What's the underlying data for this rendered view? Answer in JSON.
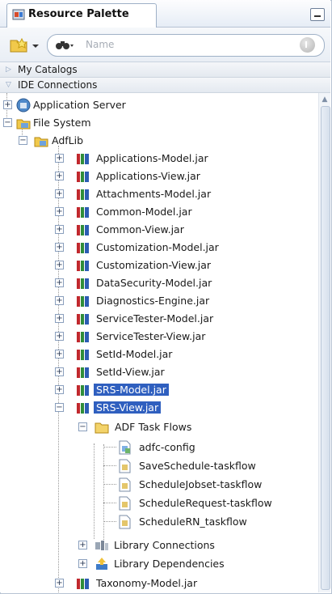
{
  "panel": {
    "title": "Resource Palette"
  },
  "search": {
    "placeholder": "Name"
  },
  "sections": {
    "my_catalogs": "My Catalogs",
    "ide_connections": "IDE Connections"
  },
  "tree": {
    "application_server": "Application Server",
    "file_system": "File System",
    "adflib": "AdfLib",
    "jars": [
      "Applications-Model.jar",
      "Applications-View.jar",
      "Attachments-Model.jar",
      "Common-Model.jar",
      "Common-View.jar",
      "Customization-Model.jar",
      "Customization-View.jar",
      "DataSecurity-Model.jar",
      "Diagnostics-Engine.jar",
      "ServiceTester-Model.jar",
      "ServiceTester-View.jar",
      "SetId-Model.jar",
      "SetId-View.jar",
      "SRS-Model.jar",
      "SRS-View.jar"
    ],
    "adf_task_flows": "ADF Task Flows",
    "task_flows": [
      "adfc-config",
      "SaveSchedule-taskflow",
      "ScheduleJobset-taskflow",
      "ScheduleRequest-taskflow",
      "ScheduleRN_taskflow"
    ],
    "library_connections": "Library Connections",
    "library_dependencies": "Library Dependencies",
    "last_jar": "Taxonomy-Model.jar"
  },
  "colors": {
    "selection": "#2f5fbf",
    "accent": "#b7c3d3"
  }
}
